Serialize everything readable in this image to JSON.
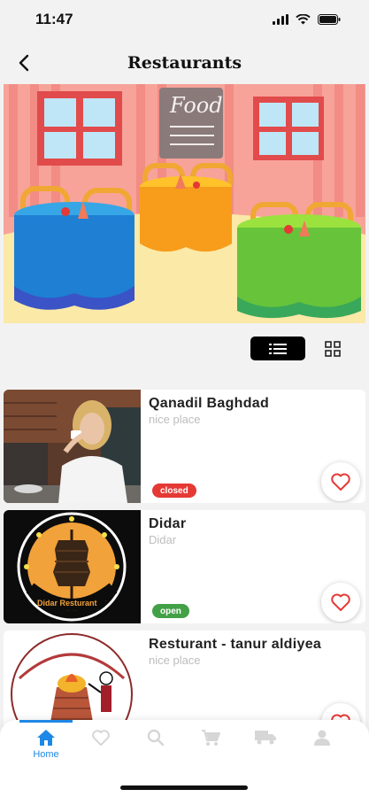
{
  "status": {
    "time": "11:47"
  },
  "header": {
    "title": "Restaurants"
  },
  "hero": {
    "sign_text": "Food"
  },
  "restaurants": [
    {
      "name": "Qanadil Baghdad",
      "subtitle": "nice place",
      "status": "closed",
      "logo_text": ""
    },
    {
      "name": "Didar",
      "subtitle": "Didar",
      "status": "open",
      "logo_text": "Didar Resturant"
    },
    {
      "name": "Resturant - tanur aldiyea",
      "subtitle": "nice place",
      "status": "",
      "logo_text": ""
    }
  ],
  "tabs": [
    {
      "label": "Home",
      "icon": "home-icon",
      "active": true
    },
    {
      "label": "",
      "icon": "heart-icon",
      "active": false
    },
    {
      "label": "",
      "icon": "search-icon",
      "active": false
    },
    {
      "label": "",
      "icon": "cart-icon",
      "active": false
    },
    {
      "label": "",
      "icon": "truck-icon",
      "active": false
    },
    {
      "label": "",
      "icon": "person-icon",
      "active": false
    }
  ],
  "colors": {
    "accent": "#1e88e5",
    "closed": "#e53935",
    "open": "#43a047",
    "inactive_icon": "#d6d6d6"
  }
}
